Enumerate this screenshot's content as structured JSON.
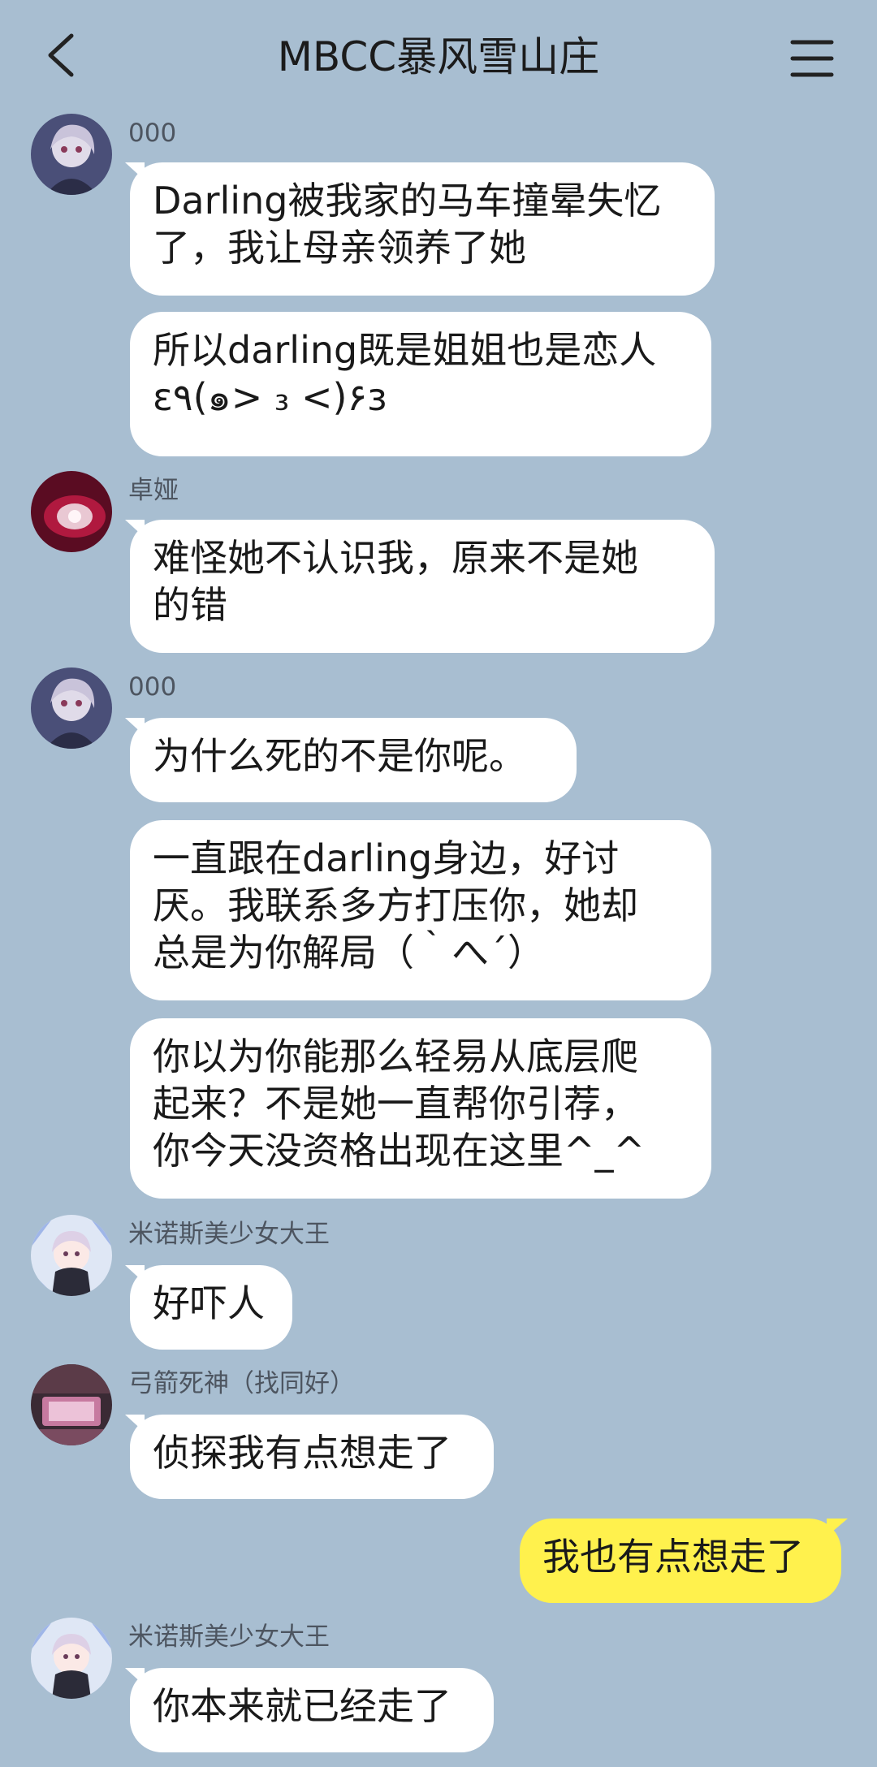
{
  "header": {
    "title": "MBCC暴风雪山庄",
    "back_icon": "chevron-left-icon",
    "menu_icon": "hamburger-menu-icon"
  },
  "colors": {
    "background": "#a8bed1",
    "bubble_other": "#ffffff",
    "bubble_me": "#fff14d"
  },
  "messages": [
    {
      "sender": "000",
      "text": "Darling被我家的马车撞晕失忆\n了，我让母亲领养了她"
    },
    {
      "text": "所以darling既是姐姐也是恋人\nε٩(๑> ₃ <)۶з"
    },
    {
      "sender": "卓娅",
      "text": "难怪她不认识我，原来不是她\n的错"
    },
    {
      "sender": "000",
      "text": "为什么死的不是你呢。"
    },
    {
      "text": "一直跟在darling身边，好讨\n厌。我联系多方打压你，她却\n总是为你解局（｀へ´）"
    },
    {
      "text": "你以为你能那么轻易从底层爬\n起来？不是她一直帮你引荐，\n你今天没资格出现在这里^_^"
    },
    {
      "sender": "米诺斯美少女大王",
      "text": "好吓人"
    },
    {
      "sender": "弓箭死神（找同好）",
      "text": "侦探我有点想走了"
    },
    {
      "text": "我也有点想走了",
      "mine": true
    },
    {
      "sender": "米诺斯美少女大王",
      "text": "你本来就已经走了"
    }
  ]
}
